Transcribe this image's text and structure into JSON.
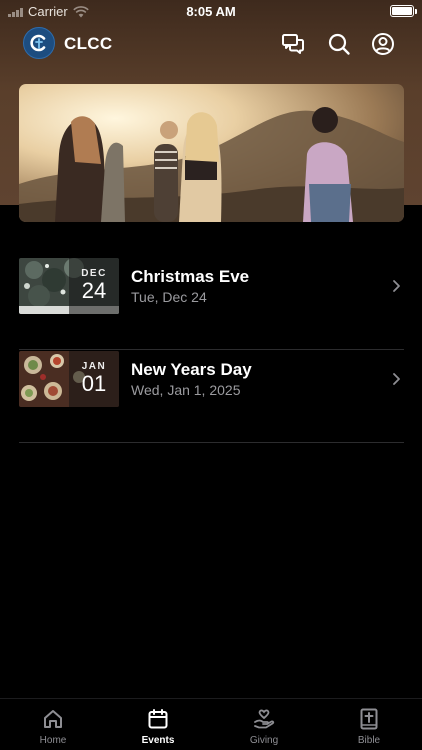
{
  "status_bar": {
    "carrier": "Carrier",
    "time": "8:05 AM"
  },
  "header": {
    "title": "CLCC",
    "icons": [
      "logo-icon",
      "chat-icon",
      "search-icon",
      "account-icon"
    ]
  },
  "hero": {
    "image": "group-of-friends-at-sunset-photo"
  },
  "events": [
    {
      "title": "Christmas Eve",
      "date": "Tue, Dec 24",
      "month": "DEC",
      "day": "24",
      "thumb": "snowy-trees-photo"
    },
    {
      "title": "New Years Day",
      "date": "Wed, Jan 1, 2025",
      "month": "JAN",
      "day": "01",
      "thumb": "dinner-table-photo"
    }
  ],
  "tabs": [
    {
      "label": "Home",
      "icon": "home-icon",
      "active": false
    },
    {
      "label": "Events",
      "icon": "calendar-icon",
      "active": true
    },
    {
      "label": "Giving",
      "icon": "giving-hand-heart-icon",
      "active": false
    },
    {
      "label": "Bible",
      "icon": "bible-icon",
      "active": false
    }
  ],
  "colors": {
    "header_brown": "#5a3f2b",
    "logo_blue": "#1d4d80",
    "background": "#000000"
  }
}
